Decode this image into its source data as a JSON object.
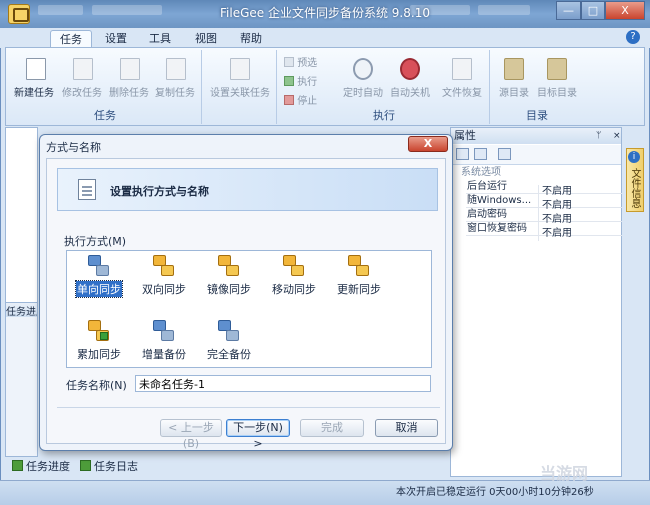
{
  "window": {
    "title": "FileGee 企业文件同步备份系统 9.8.10"
  },
  "menu": {
    "tabs": [
      "任务",
      "设置",
      "工具",
      "视图",
      "帮助"
    ],
    "help_icon": "?"
  },
  "ribbon": {
    "groups": [
      {
        "label": "任务",
        "buttons": [
          "新建任务",
          "修改任务",
          "删除任务",
          "复制任务"
        ]
      },
      {
        "label": "",
        "buttons": [
          "设置关联任务"
        ]
      },
      {
        "label": "执行",
        "small_buttons": [
          "预选",
          "执行",
          "停止"
        ],
        "buttons": [
          "定时自动",
          "自动关机",
          "文件恢复"
        ]
      },
      {
        "label": "目录",
        "buttons": [
          "源目录",
          "目标目录"
        ]
      }
    ]
  },
  "left_pane": {
    "section_title": "任务进度"
  },
  "bottom_tabs": [
    "任务进度",
    "任务日志"
  ],
  "status": {
    "text": "本次开启已稳定运行 0天00小时10分钟26秒"
  },
  "watermark": "当游网",
  "properties": {
    "header": "属性",
    "pin": "ᛘ",
    "close": "×",
    "section": "系统选项",
    "rows": [
      {
        "name": "后台运行",
        "value": "不启用"
      },
      {
        "name": "随Windows...",
        "value": "不启用"
      },
      {
        "name": "启动密码",
        "value": "不启用"
      },
      {
        "name": "窗口恢复密码",
        "value": "不启用"
      }
    ],
    "side_tab": "文件信息",
    "side_info": "i"
  },
  "dialog": {
    "title": "方式与名称",
    "close": "X",
    "banner": "设置执行方式与名称",
    "mode_label": "执行方式(M)",
    "modes": [
      "单向同步",
      "双向同步",
      "镜像同步",
      "移动同步",
      "更新同步",
      "累加同步",
      "增量备份",
      "完全备份"
    ],
    "selected_mode": "单向同步",
    "name_label": "任务名称(N)",
    "name_value": "未命名任务-1",
    "buttons": {
      "prev": "< 上一步(B)",
      "next": "下一步(N) >",
      "finish": "完成",
      "cancel": "取消"
    }
  },
  "caption_buttons": {
    "minimize": "—",
    "maximize": "□",
    "close": "X"
  }
}
